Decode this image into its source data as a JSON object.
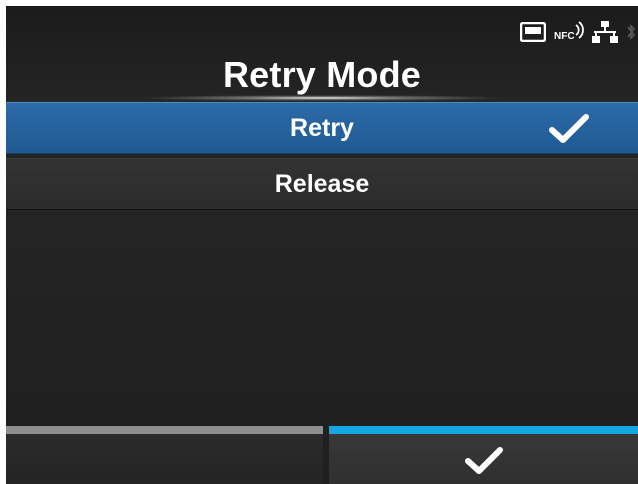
{
  "header": {
    "title": "Retry Mode",
    "status_icons": [
      "sd-card-icon",
      "nfc-icon",
      "network-icon",
      "bluetooth-icon"
    ],
    "nfc_label": "NFC"
  },
  "options": [
    {
      "label": "Retry",
      "selected": true
    },
    {
      "label": "Release",
      "selected": false
    }
  ],
  "softkeys": {
    "left": {
      "label": ""
    },
    "right": {
      "icon": "checkmark-icon"
    }
  },
  "colors": {
    "selected_row": "#2563a0",
    "confirm_bar": "#17a6e4",
    "left_bar": "#8f8f8f"
  }
}
